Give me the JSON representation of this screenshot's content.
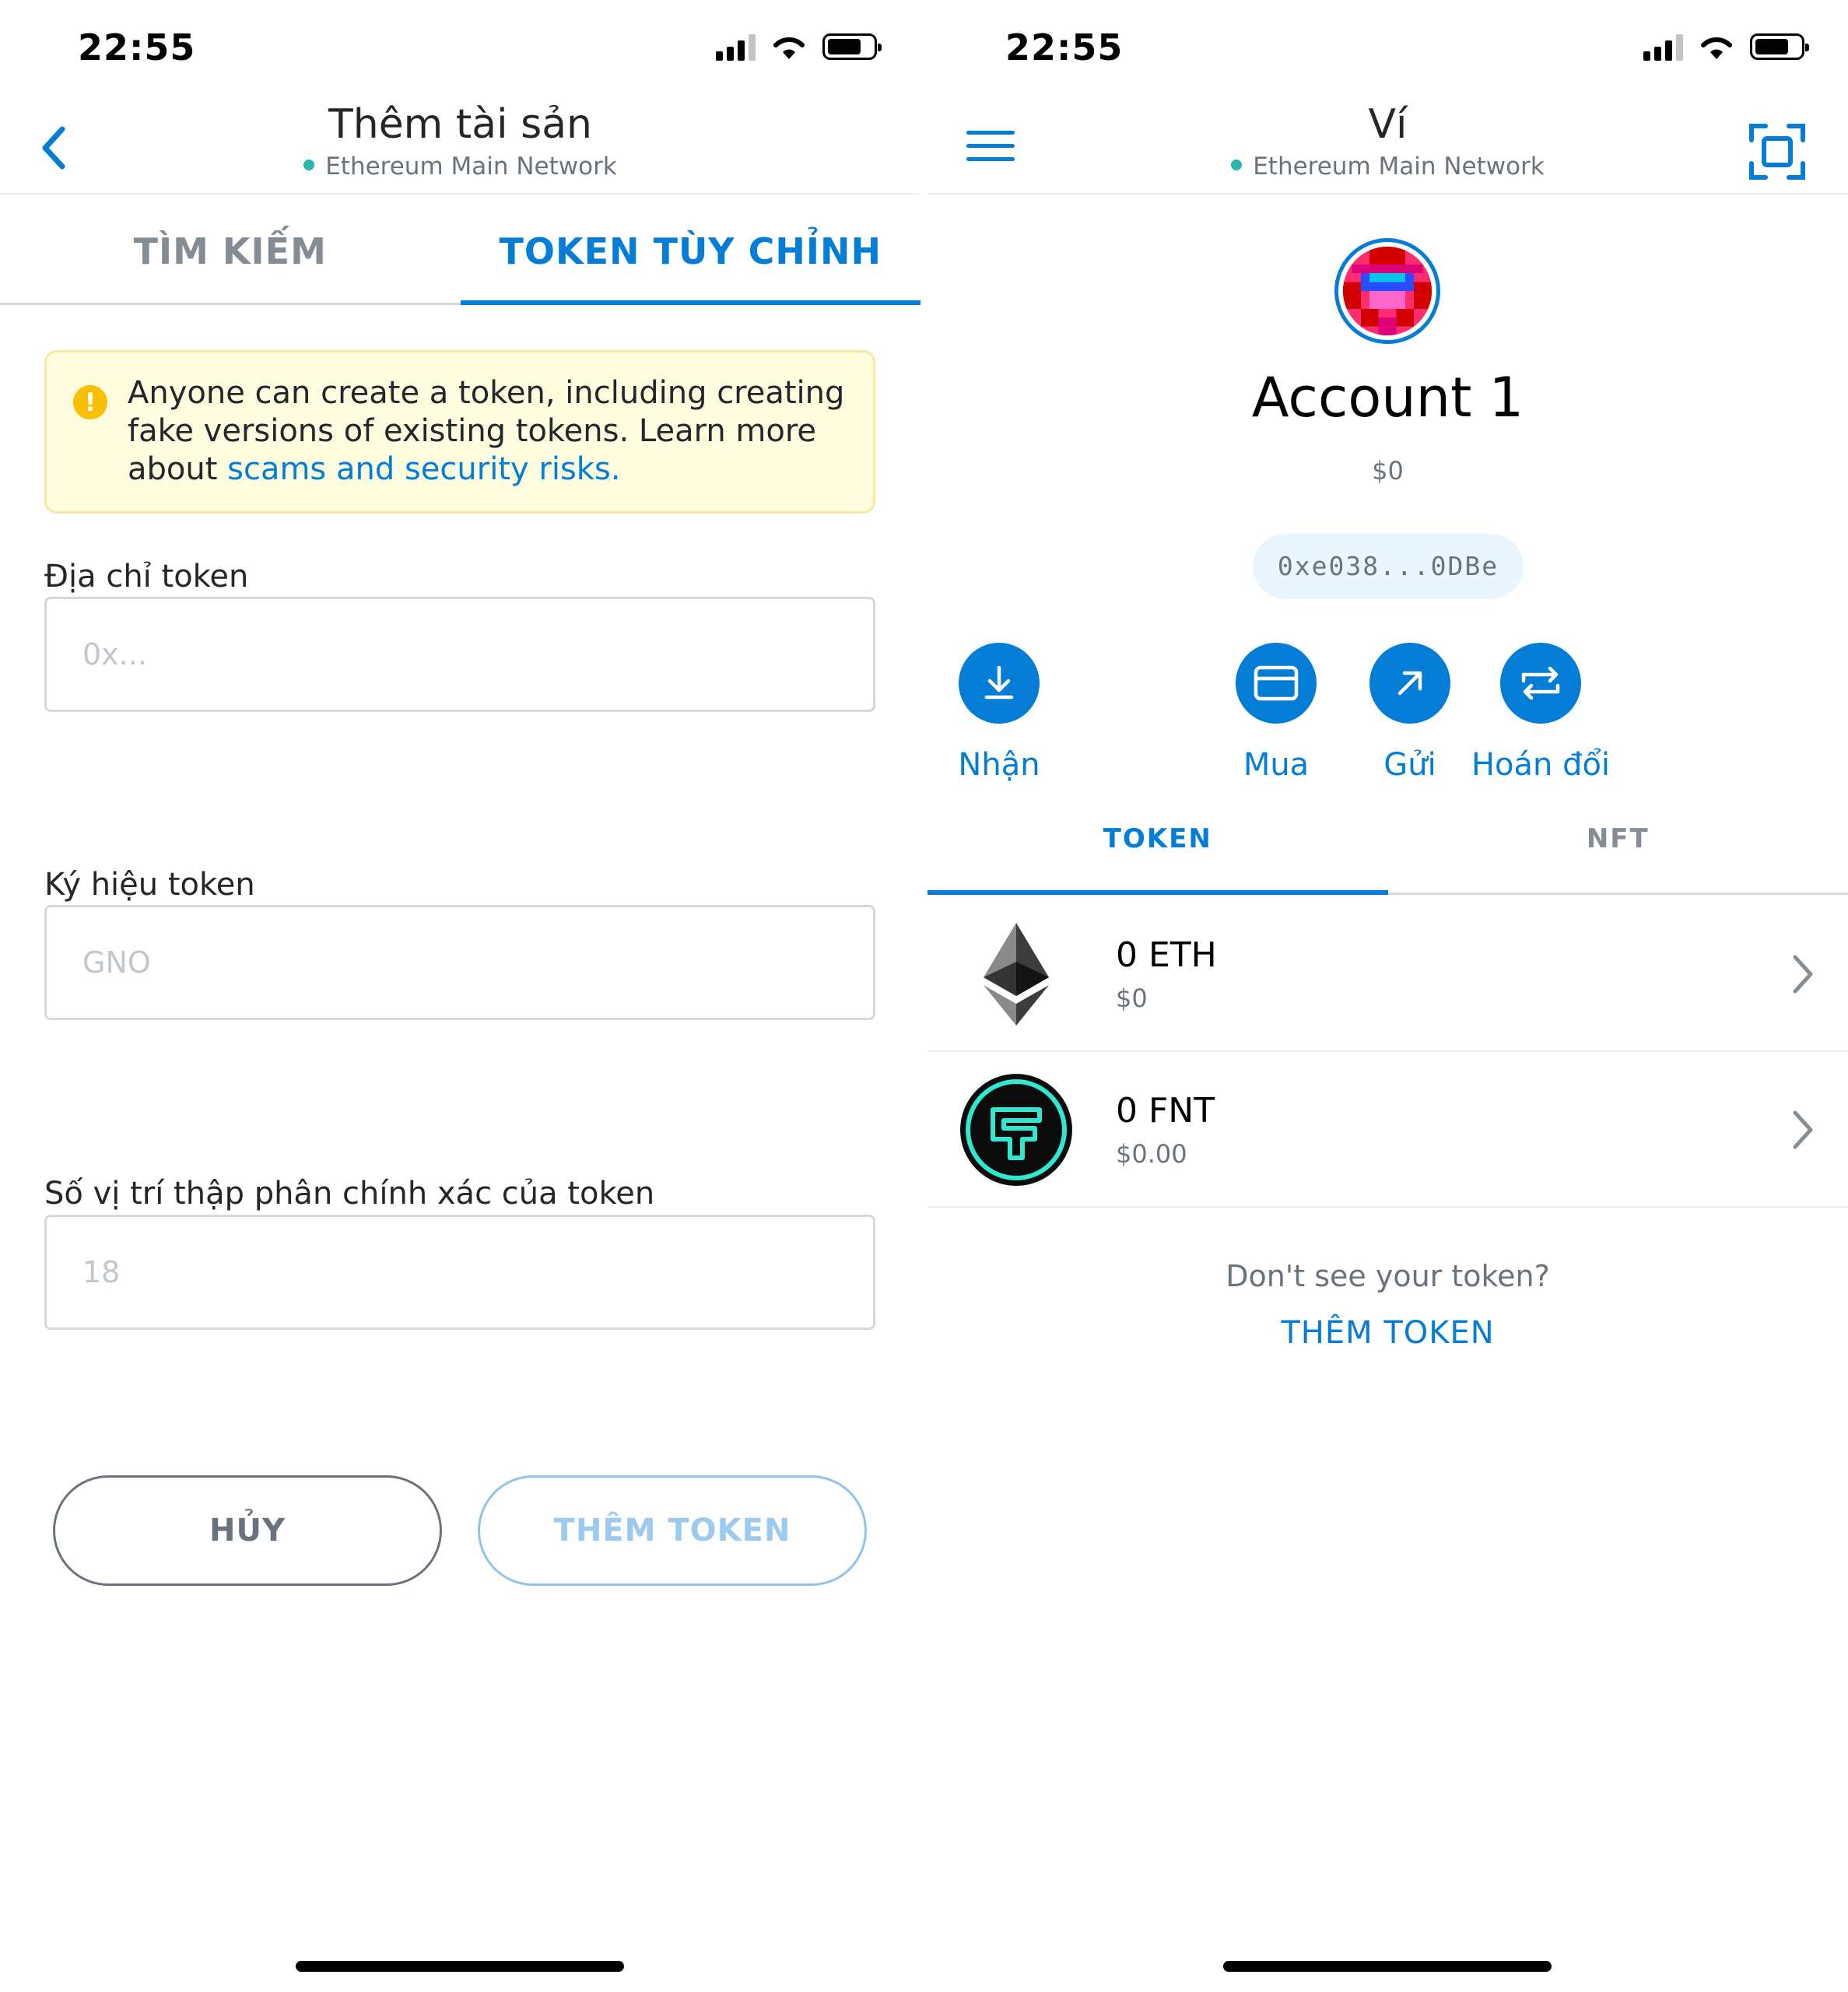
{
  "left": {
    "status": {
      "time": "22:55"
    },
    "header": {
      "title": "Thêm tài sản",
      "network": "Ethereum Main Network"
    },
    "tabs": [
      {
        "label": "TÌM KIẾM",
        "active": false
      },
      {
        "label": "TOKEN TÙY CHỈNH",
        "active": true
      }
    ],
    "warning": {
      "text": "Anyone can create a token, including creating fake versions of existing tokens. Learn more about ",
      "link": "scams and security risks."
    },
    "fields": [
      {
        "label": "Địa chỉ token",
        "placeholder": "0x...",
        "value": ""
      },
      {
        "label": "Ký hiệu token",
        "placeholder": "GNO",
        "value": ""
      },
      {
        "label": "Số vị trí thập phân chính xác của token",
        "placeholder": "18",
        "value": ""
      }
    ],
    "buttons": {
      "cancel": "HỦY",
      "add": "THÊM TOKEN"
    }
  },
  "right": {
    "status": {
      "time": "22:55"
    },
    "header": {
      "title": "Ví",
      "network": "Ethereum Main Network"
    },
    "account": {
      "name": "Account 1",
      "balance": "$0",
      "address": "0xe038...0DBe"
    },
    "actions": [
      {
        "label": "Nhận",
        "icon": "receive-icon"
      },
      {
        "label": "Mua",
        "icon": "card-icon"
      },
      {
        "label": "Gửi",
        "icon": "send-arrow-icon"
      },
      {
        "label": "Hoán đổi",
        "icon": "swap-icon"
      }
    ],
    "tabs": [
      {
        "label": "TOKEN",
        "active": true
      },
      {
        "label": "NFT",
        "active": false
      }
    ],
    "tokens": [
      {
        "amount": "0 ETH",
        "fiat": "$0",
        "icon": "ethereum-icon"
      },
      {
        "amount": "0 FNT",
        "fiat": "$0.00",
        "icon": "fnt-token-icon"
      }
    ],
    "footer": {
      "prompt": "Don't see your token?",
      "link": "THÊM TOKEN"
    }
  },
  "colors": {
    "accent": "#037dd6",
    "warning_bg": "#fefcde",
    "warning_border": "#f8e7a0",
    "network_dot": "#29b6af"
  }
}
